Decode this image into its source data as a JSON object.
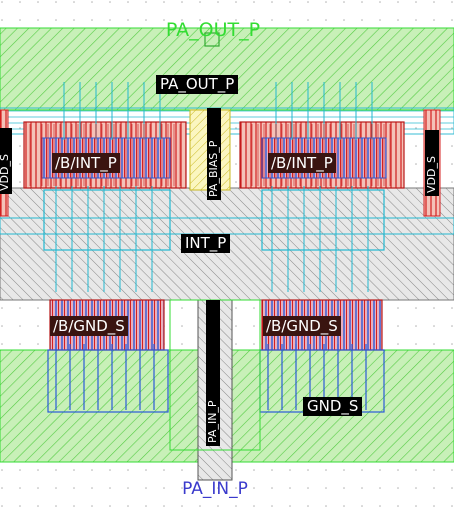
{
  "pins": {
    "top": "PA_OUT_P",
    "bottom": "PA_IN_P"
  },
  "labels": {
    "pa_out": "PA_OUT_P",
    "int_p": "INT_P",
    "gnd_s": "GND_S",
    "pa_in_vert": "PA_IN_P",
    "pa_bias_vert": "PA_BIAS_P",
    "vdd_left_vert": "VDD_S",
    "vdd_right_vert": "VDD_S",
    "dev_int_left": "/B/INT_P",
    "dev_int_right": "/B/INT_P",
    "dev_gnd_left": "/B/GND_S",
    "dev_gnd_right": "/B/GND_S"
  },
  "colors": {
    "metal_green": "#33dd33",
    "hatch_gray": "#8a8a8a",
    "poly_red": "#d42020",
    "via_blue": "#2a5bd8",
    "cyan": "#22b8d0",
    "pin_text": "#33dd33",
    "bottom_pin_text": "#3a3acc"
  }
}
